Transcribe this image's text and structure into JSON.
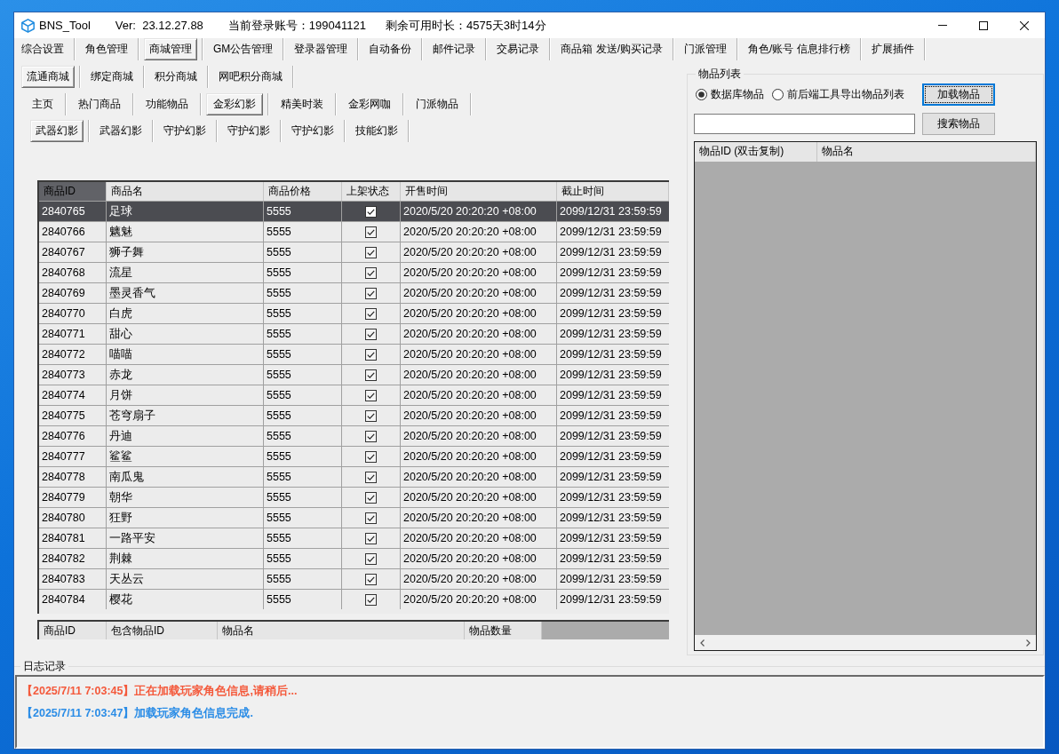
{
  "window": {
    "title": "BNS_Tool",
    "version": "Ver:  23.12.27.88",
    "account": "当前登录账号：199041121",
    "remaining_time": "剩余可用时长：4575天3时14分"
  },
  "main_tabs": [
    {
      "label": "综合设置",
      "selected": false
    },
    {
      "label": "角色管理",
      "selected": false
    },
    {
      "label": "商城管理",
      "selected": true
    },
    {
      "label": "GM公告管理",
      "selected": false
    },
    {
      "label": "登录器管理",
      "selected": false
    },
    {
      "label": "自动备份",
      "selected": false
    },
    {
      "label": "邮件记录",
      "selected": false
    },
    {
      "label": "交易记录",
      "selected": false
    },
    {
      "label": "商品箱 发送/购买记录",
      "selected": false
    },
    {
      "label": "门派管理",
      "selected": false
    },
    {
      "label": "角色/账号 信息排行榜",
      "selected": false
    },
    {
      "label": "扩展插件",
      "selected": false
    }
  ],
  "shop_tabs": [
    {
      "label": "流通商城",
      "selected": true
    },
    {
      "label": "绑定商城",
      "selected": false
    },
    {
      "label": "积分商城",
      "selected": false
    },
    {
      "label": "网吧积分商城",
      "selected": false
    }
  ],
  "category_tabs": [
    {
      "label": "主页",
      "selected": false
    },
    {
      "label": "热门商品",
      "selected": false
    },
    {
      "label": "功能物品",
      "selected": false
    },
    {
      "label": "金彩幻影",
      "selected": true
    },
    {
      "label": "精美时装",
      "selected": false
    },
    {
      "label": "金彩网咖",
      "selected": false
    },
    {
      "label": "门派物品",
      "selected": false
    }
  ],
  "subcategory_tabs": [
    {
      "label": "武器幻影",
      "selected": true
    },
    {
      "label": "武器幻影",
      "selected": false
    },
    {
      "label": "守护幻影",
      "selected": false
    },
    {
      "label": "守护幻影",
      "selected": false
    },
    {
      "label": "守护幻影",
      "selected": false
    },
    {
      "label": "技能幻影",
      "selected": false
    }
  ],
  "product_table": {
    "columns": [
      {
        "label": "商品ID",
        "selected": true
      },
      {
        "label": "商品名",
        "selected": false
      },
      {
        "label": "商品价格",
        "selected": false
      },
      {
        "label": "上架状态",
        "selected": false
      },
      {
        "label": "开售时间",
        "selected": false
      },
      {
        "label": "截止时间",
        "selected": false
      }
    ],
    "rows": [
      {
        "id": "2840765",
        "name": "足球",
        "price": "5555",
        "listed": true,
        "start_time": "2020/5/20 20:20:20 +08:00",
        "end_time": "2099/12/31 23:59:59",
        "selected": true
      },
      {
        "id": "2840766",
        "name": "魑魅",
        "price": "5555",
        "listed": true,
        "start_time": "2020/5/20 20:20:20 +08:00",
        "end_time": "2099/12/31 23:59:59",
        "selected": false
      },
      {
        "id": "2840767",
        "name": "狮子舞",
        "price": "5555",
        "listed": true,
        "start_time": "2020/5/20 20:20:20 +08:00",
        "end_time": "2099/12/31 23:59:59",
        "selected": false
      },
      {
        "id": "2840768",
        "name": "流星",
        "price": "5555",
        "listed": true,
        "start_time": "2020/5/20 20:20:20 +08:00",
        "end_time": "2099/12/31 23:59:59",
        "selected": false
      },
      {
        "id": "2840769",
        "name": "墨灵香气",
        "price": "5555",
        "listed": true,
        "start_time": "2020/5/20 20:20:20 +08:00",
        "end_time": "2099/12/31 23:59:59",
        "selected": false
      },
      {
        "id": "2840770",
        "name": "白虎",
        "price": "5555",
        "listed": true,
        "start_time": "2020/5/20 20:20:20 +08:00",
        "end_time": "2099/12/31 23:59:59",
        "selected": false
      },
      {
        "id": "2840771",
        "name": "甜心",
        "price": "5555",
        "listed": true,
        "start_time": "2020/5/20 20:20:20 +08:00",
        "end_time": "2099/12/31 23:59:59",
        "selected": false
      },
      {
        "id": "2840772",
        "name": "喵喵",
        "price": "5555",
        "listed": true,
        "start_time": "2020/5/20 20:20:20 +08:00",
        "end_time": "2099/12/31 23:59:59",
        "selected": false
      },
      {
        "id": "2840773",
        "name": "赤龙",
        "price": "5555",
        "listed": true,
        "start_time": "2020/5/20 20:20:20 +08:00",
        "end_time": "2099/12/31 23:59:59",
        "selected": false
      },
      {
        "id": "2840774",
        "name": "月饼",
        "price": "5555",
        "listed": true,
        "start_time": "2020/5/20 20:20:20 +08:00",
        "end_time": "2099/12/31 23:59:59",
        "selected": false
      },
      {
        "id": "2840775",
        "name": "苍穹扇子",
        "price": "5555",
        "listed": true,
        "start_time": "2020/5/20 20:20:20 +08:00",
        "end_time": "2099/12/31 23:59:59",
        "selected": false
      },
      {
        "id": "2840776",
        "name": "丹迪",
        "price": "5555",
        "listed": true,
        "start_time": "2020/5/20 20:20:20 +08:00",
        "end_time": "2099/12/31 23:59:59",
        "selected": false
      },
      {
        "id": "2840777",
        "name": "鲨鲨",
        "price": "5555",
        "listed": true,
        "start_time": "2020/5/20 20:20:20 +08:00",
        "end_time": "2099/12/31 23:59:59",
        "selected": false
      },
      {
        "id": "2840778",
        "name": "南瓜鬼",
        "price": "5555",
        "listed": true,
        "start_time": "2020/5/20 20:20:20 +08:00",
        "end_time": "2099/12/31 23:59:59",
        "selected": false
      },
      {
        "id": "2840779",
        "name": "朝华",
        "price": "5555",
        "listed": true,
        "start_time": "2020/5/20 20:20:20 +08:00",
        "end_time": "2099/12/31 23:59:59",
        "selected": false
      },
      {
        "id": "2840780",
        "name": "狂野",
        "price": "5555",
        "listed": true,
        "start_time": "2020/5/20 20:20:20 +08:00",
        "end_time": "2099/12/31 23:59:59",
        "selected": false
      },
      {
        "id": "2840781",
        "name": "一路平安",
        "price": "5555",
        "listed": true,
        "start_time": "2020/5/20 20:20:20 +08:00",
        "end_time": "2099/12/31 23:59:59",
        "selected": false
      },
      {
        "id": "2840782",
        "name": "荆棘",
        "price": "5555",
        "listed": true,
        "start_time": "2020/5/20 20:20:20 +08:00",
        "end_time": "2099/12/31 23:59:59",
        "selected": false
      },
      {
        "id": "2840783",
        "name": "天丛云",
        "price": "5555",
        "listed": true,
        "start_time": "2020/5/20 20:20:20 +08:00",
        "end_time": "2099/12/31 23:59:59",
        "selected": false
      },
      {
        "id": "2840784",
        "name": "樱花",
        "price": "5555",
        "listed": true,
        "start_time": "2020/5/20 20:20:20 +08:00",
        "end_time": "2099/12/31 23:59:59",
        "selected": false
      }
    ]
  },
  "contents_table": {
    "columns": [
      "商品ID",
      "包含物品ID",
      "物品名",
      "物品数量"
    ]
  },
  "item_list": {
    "title": "物品列表",
    "sources": [
      {
        "label": "数据库物品",
        "selected": true
      },
      {
        "label": "前后端工具导出物品列表",
        "selected": false
      }
    ],
    "load_button": {
      "label": "加载物品",
      "focused": true
    },
    "search_button": {
      "label": "搜索物品",
      "focused": false
    },
    "columns": [
      "物品ID (双击复制)",
      "物品名"
    ]
  },
  "log": {
    "title": "日志记录",
    "entries": [
      {
        "text": "【2025/7/11 7:03:45】正在加载玩家角色信息,请稍后...",
        "color": "#f4593b"
      },
      {
        "text": "【2025/7/11 7:03:47】加载玩家角色信息完成.",
        "color": "#2a8ce6"
      }
    ]
  }
}
